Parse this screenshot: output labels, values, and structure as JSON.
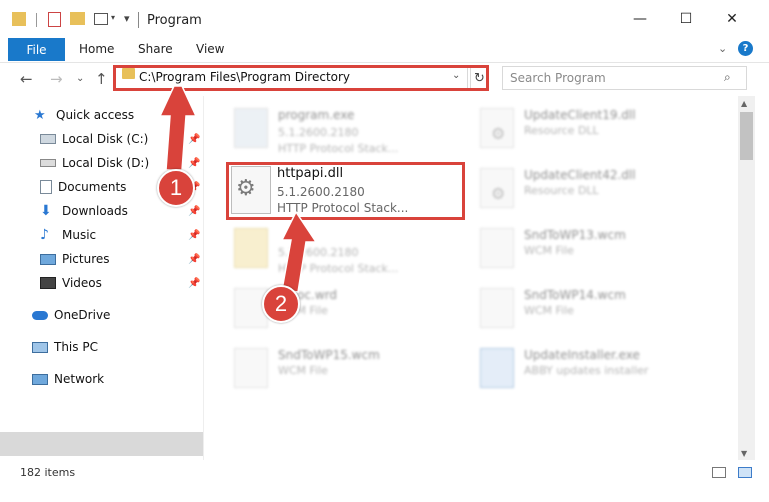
{
  "window": {
    "title": "Program",
    "minimize_glyph": "—",
    "maximize_glyph": "☐",
    "close_glyph": "✕"
  },
  "ribbon": {
    "file": "File",
    "home": "Home",
    "share": "Share",
    "view": "View",
    "expand_glyph": "⌄",
    "help_glyph": "?"
  },
  "address": {
    "path": "C:\\Program Files\\Program Directory",
    "back_glyph": "←",
    "forward_glyph": "→",
    "recent_glyph": "⌄",
    "up_glyph": "↑",
    "dropdown_glyph": "⌄",
    "refresh_glyph": "↻"
  },
  "search": {
    "placeholder": "Search Program",
    "icon_glyph": "⌕"
  },
  "nav": {
    "quick_access": "Quick access",
    "local_c": "Local Disk (C:)",
    "local_d": "Local Disk (D:)",
    "documents": "Documents",
    "downloads": "Downloads",
    "music": "Music",
    "pictures": "Pictures",
    "videos": "Videos",
    "onedrive": "OneDrive",
    "this_pc": "This PC",
    "network": "Network",
    "pin_glyph": "📌"
  },
  "files": {
    "program_exe": {
      "name": "program.exe",
      "l1": "5.1.2600.2180",
      "l2": "HTTP Protocol Stack..."
    },
    "highlighted": {
      "name": "httpapi.dll",
      "l1": "5.1.2600.2180",
      "l2": "HTTP Protocol Stack..."
    },
    "blur3": {
      "l1": "5.1.2600.2180",
      "l2": "HTTP Protocol Stack..."
    },
    "blur4": {
      "name": "...doc.wrd",
      "l1": "WCM File"
    },
    "sndtowp15": {
      "name": "SndToWP15.wcm",
      "l1": "WCM File"
    },
    "updateclient19": {
      "name": "UpdateClient19.dll",
      "l1": "Resource DLL"
    },
    "updateclient42": {
      "name": "UpdateClient42.dll",
      "l1": "Resource DLL"
    },
    "sndtowp13": {
      "name": "SndToWP13.wcm",
      "l1": "WCM File"
    },
    "sndtowp14": {
      "name": "SndToWP14.wcm",
      "l1": "WCM File"
    },
    "updateinstaller": {
      "name": "UpdateInstaller.exe",
      "l1": "ABBY updates installer"
    },
    "gear_glyph": "⚙"
  },
  "scroll": {
    "up_glyph": "▲",
    "down_glyph": "▼"
  },
  "status": {
    "items": "182 items"
  },
  "annotations": {
    "step1": "1",
    "step2": "2",
    "color": "#d9433b"
  }
}
